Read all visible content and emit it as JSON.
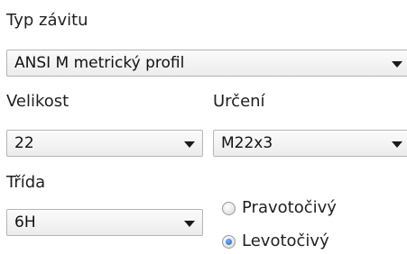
{
  "thread_type": {
    "label": "Typ závitu",
    "value": "ANSI M metrický profil"
  },
  "size": {
    "label": "Velikost",
    "value": "22"
  },
  "designation": {
    "label": "Určení",
    "value": "M22x3"
  },
  "class": {
    "label": "Třída",
    "value": "6H"
  },
  "direction": {
    "right_hand": {
      "label": "Pravotočivý",
      "checked": false
    },
    "left_hand": {
      "label": "Levotočivý",
      "checked": true
    }
  },
  "icons": {
    "dropdown": "chevron-down-icon",
    "radio_unchecked": "radio-unchecked-icon",
    "radio_checked": "radio-checked-icon"
  },
  "colors": {
    "radio_selected": "#1c5fc6",
    "border": "#b5b5b5"
  }
}
